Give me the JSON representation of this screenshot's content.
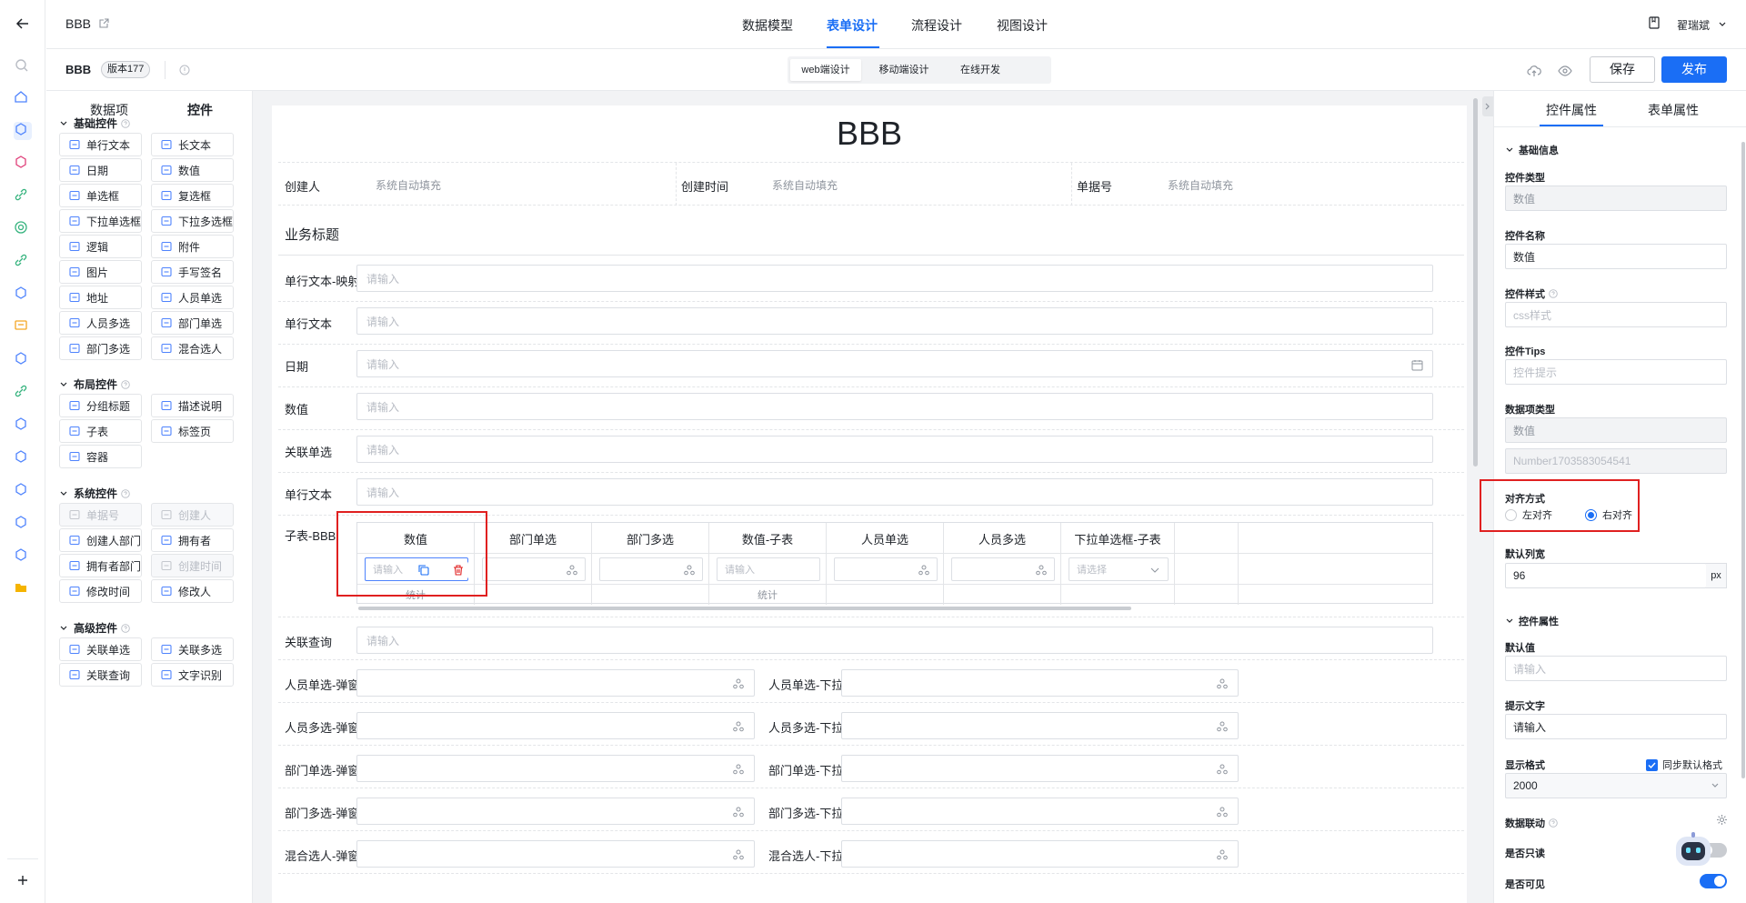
{
  "header": {
    "app_title": "BBB",
    "nav_tabs": [
      "数据模型",
      "表单设计",
      "流程设计",
      "视图设计"
    ],
    "active_tab": "表单设计",
    "user_name": "翟瑞斌"
  },
  "subheader": {
    "form_name": "BBB",
    "version": "版本177",
    "mode_tabs": [
      "web端设计",
      "移动端设计",
      "在线开发"
    ],
    "save_label": "保存",
    "publish_label": "发布"
  },
  "left_panel": {
    "tabs": [
      "数据项",
      "控件"
    ],
    "groups": [
      {
        "title": "基础控件",
        "items": [
          {
            "label": "单行文本",
            "icon": "single-line-text-icon"
          },
          {
            "label": "长文本",
            "icon": "long-text-icon"
          },
          {
            "label": "日期",
            "icon": "date-icon"
          },
          {
            "label": "数值",
            "icon": "number-icon"
          },
          {
            "label": "单选框",
            "icon": "radio-icon"
          },
          {
            "label": "复选框",
            "icon": "checkbox-icon"
          },
          {
            "label": "下拉单选框",
            "icon": "dropdown-single-icon"
          },
          {
            "label": "下拉多选框",
            "icon": "dropdown-multi-icon"
          },
          {
            "label": "逻辑",
            "icon": "toggle-icon"
          },
          {
            "label": "附件",
            "icon": "attachment-icon"
          },
          {
            "label": "图片",
            "icon": "image-icon"
          },
          {
            "label": "手写签名",
            "icon": "signature-icon"
          },
          {
            "label": "地址",
            "icon": "location-icon"
          },
          {
            "label": "人员单选",
            "icon": "user-icon"
          },
          {
            "label": "人员多选",
            "icon": "users-icon"
          },
          {
            "label": "部门单选",
            "icon": "department-icon"
          },
          {
            "label": "部门多选",
            "icon": "departments-icon"
          },
          {
            "label": "混合选人",
            "icon": "mixed-user-icon"
          }
        ]
      },
      {
        "title": "布局控件",
        "items": [
          {
            "label": "分组标题",
            "icon": "group-title-icon"
          },
          {
            "label": "描述说明",
            "icon": "help-icon"
          },
          {
            "label": "子表",
            "icon": "table-icon"
          },
          {
            "label": "标签页",
            "icon": "tabs-icon"
          },
          {
            "label": "容器",
            "icon": "container-icon"
          }
        ]
      },
      {
        "title": "系统控件",
        "items": [
          {
            "label": "单据号",
            "icon": "document-number-icon",
            "disabled": true
          },
          {
            "label": "创建人",
            "icon": "creator-icon",
            "disabled": true
          },
          {
            "label": "创建人部门",
            "icon": "creator-dept-icon"
          },
          {
            "label": "拥有者",
            "icon": "owner-icon"
          },
          {
            "label": "拥有者部门",
            "icon": "owner-dept-icon"
          },
          {
            "label": "创建时间",
            "icon": "created-time-icon",
            "disabled": true
          },
          {
            "label": "修改时间",
            "icon": "modified-time-icon"
          },
          {
            "label": "修改人",
            "icon": "modifier-icon"
          }
        ]
      },
      {
        "title": "高级控件",
        "items": [
          {
            "label": "关联单选",
            "icon": "relation-single-icon"
          },
          {
            "label": "关联多选",
            "icon": "relation-multi-icon"
          },
          {
            "label": "关联查询",
            "icon": "relation-query-icon"
          },
          {
            "label": "文字识别",
            "icon": "ocr-icon"
          }
        ]
      }
    ]
  },
  "form": {
    "title": "BBB",
    "meta": [
      {
        "label": "创建人",
        "value": "系统自动填充"
      },
      {
        "label": "创建时间",
        "value": "系统自动填充"
      },
      {
        "label": "单据号",
        "value": "系统自动填充"
      }
    ],
    "section_title": "业务标题",
    "placeholder": "请输入",
    "select_placeholder": "请选择",
    "rows": [
      {
        "label": "单行文本-映射..."
      },
      {
        "label": "单行文本"
      },
      {
        "label": "日期",
        "icon": "calendar-icon"
      },
      {
        "label": "数值"
      },
      {
        "label": "关联单选"
      },
      {
        "label": "单行文本"
      }
    ],
    "subtable": {
      "label": "子表-BBB",
      "columns": [
        "数值",
        "部门单选",
        "部门多选",
        "数值-子表",
        "人员单选",
        "人员多选",
        "下拉单选框-子表"
      ],
      "stat_label": "统计"
    },
    "relation_query_label": "关联查询",
    "pair_rows": [
      [
        "人员单选-弹窗",
        "人员单选-下拉"
      ],
      [
        "人员多选-弹窗",
        "人员多选-下拉"
      ],
      [
        "部门单选-弹窗",
        "部门单选-下拉"
      ],
      [
        "部门多选-弹窗",
        "部门多选-下拉"
      ],
      [
        "混合选人-弹窗",
        "混合选人-下拉"
      ]
    ]
  },
  "right_panel": {
    "tabs": [
      "控件属性",
      "表单属性"
    ],
    "basic_info_title": "基础信息",
    "control_type_label": "控件类型",
    "control_type_value": "数值",
    "control_name_label": "控件名称",
    "control_name_value": "数值",
    "control_style_label": "控件样式",
    "control_style_placeholder": "css样式",
    "control_tips_label": "控件Tips",
    "control_tips_placeholder": "控件提示",
    "data_type_label": "数据项类型",
    "data_type_value": "数值",
    "data_code_value": "Number1703583054541",
    "align_label": "对齐方式",
    "align_left": "左对齐",
    "align_right": "右对齐",
    "col_width_label": "默认列宽",
    "col_width_value": "96",
    "col_width_unit": "px",
    "props_title": "控件属性",
    "default_value_label": "默认值",
    "default_value_placeholder": "请输入",
    "hint_label": "提示文字",
    "hint_value": "请输入",
    "format_label": "显示格式",
    "sync_format_label": "同步默认格式",
    "format_value": "2000",
    "linkage_label": "数据联动",
    "readonly_label": "是否只读",
    "visible_label": "是否可见"
  },
  "colors": {
    "accent": "#1a6ef5",
    "highlight_box": "#e02020"
  }
}
